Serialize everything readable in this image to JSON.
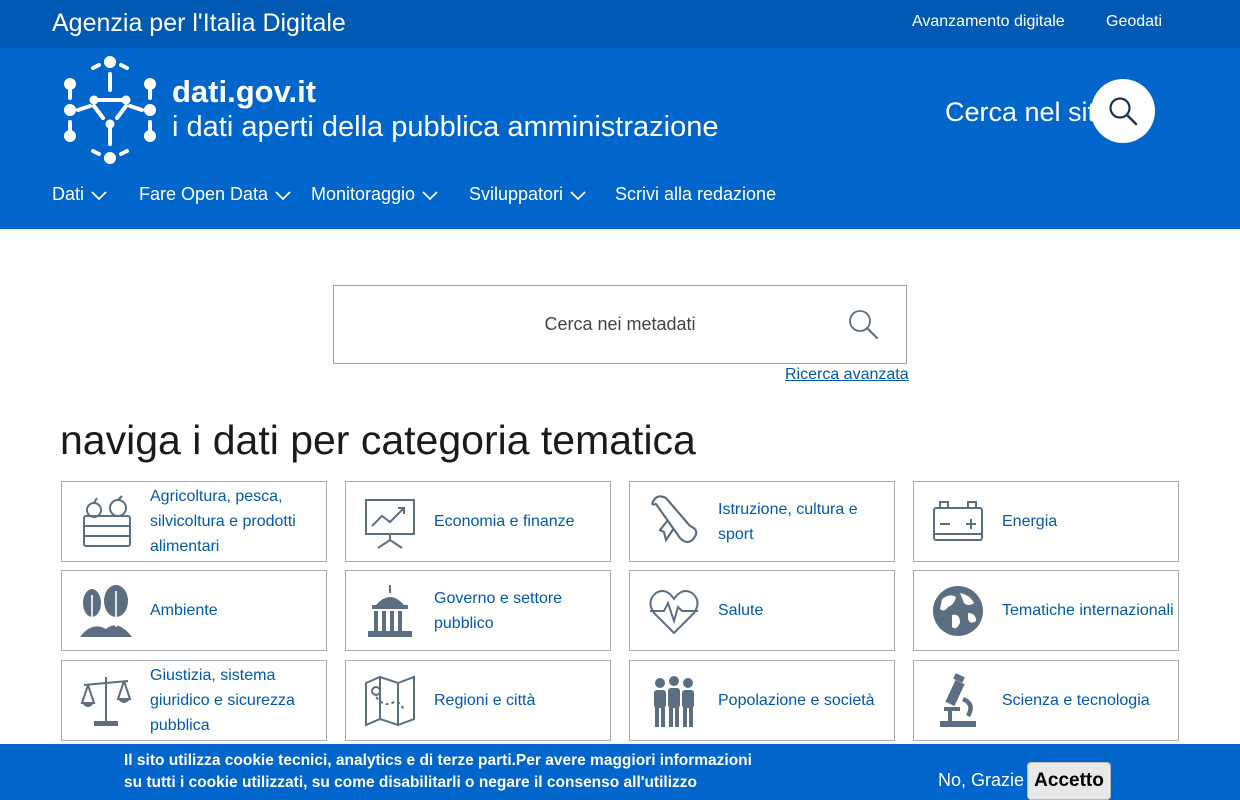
{
  "topbar": {
    "agency": "Agenzia per l'Italia Digitale",
    "links": [
      "Avanzamento digitale",
      "Geodati"
    ]
  },
  "header": {
    "title": "dati.gov.it",
    "subtitle": "i dati aperti della pubblica amministrazione",
    "search_label": "Cerca nel sito"
  },
  "nav": {
    "items": [
      "Dati",
      "Fare Open Data",
      "Monitoraggio",
      "Sviluppatori",
      "Scrivi alla redazione"
    ]
  },
  "search": {
    "placeholder": "Cerca nei metadati",
    "advanced": "Ricerca avanzata"
  },
  "categories_title": "naviga i dati per categoria tematica",
  "categories": [
    {
      "label": "Agricoltura, pesca, silvicoltura e prodotti alimentari",
      "icon": "agriculture-icon"
    },
    {
      "label": "Economia e finanze",
      "icon": "economy-icon"
    },
    {
      "label": "Istruzione, cultura e sport",
      "icon": "education-icon"
    },
    {
      "label": "Energia",
      "icon": "energy-icon"
    },
    {
      "label": "Ambiente",
      "icon": "environment-icon"
    },
    {
      "label": "Governo e settore pubblico",
      "icon": "government-icon"
    },
    {
      "label": "Salute",
      "icon": "health-icon"
    },
    {
      "label": "Tematiche internazionali",
      "icon": "globe-icon"
    },
    {
      "label": "Giustizia, sistema giuridico e sicurezza pubblica",
      "icon": "justice-icon"
    },
    {
      "label": "Regioni e città",
      "icon": "map-icon"
    },
    {
      "label": "Popolazione e società",
      "icon": "population-icon"
    },
    {
      "label": "Scienza e tecnologia",
      "icon": "microscope-icon"
    }
  ],
  "cookie": {
    "text": "Il sito utilizza cookie tecnici, analytics e di terze parti.Per avere maggiori informazioni su tutti i cookie utilizzati, su come disabilitarli o negare il consenso all'utilizzo",
    "decline": "No, Grazie",
    "accept": "Accetto"
  },
  "colors": {
    "topbar": "#0059b3",
    "header": "#0066cc",
    "link": "#0059b3",
    "icon": "#5c6f82"
  }
}
